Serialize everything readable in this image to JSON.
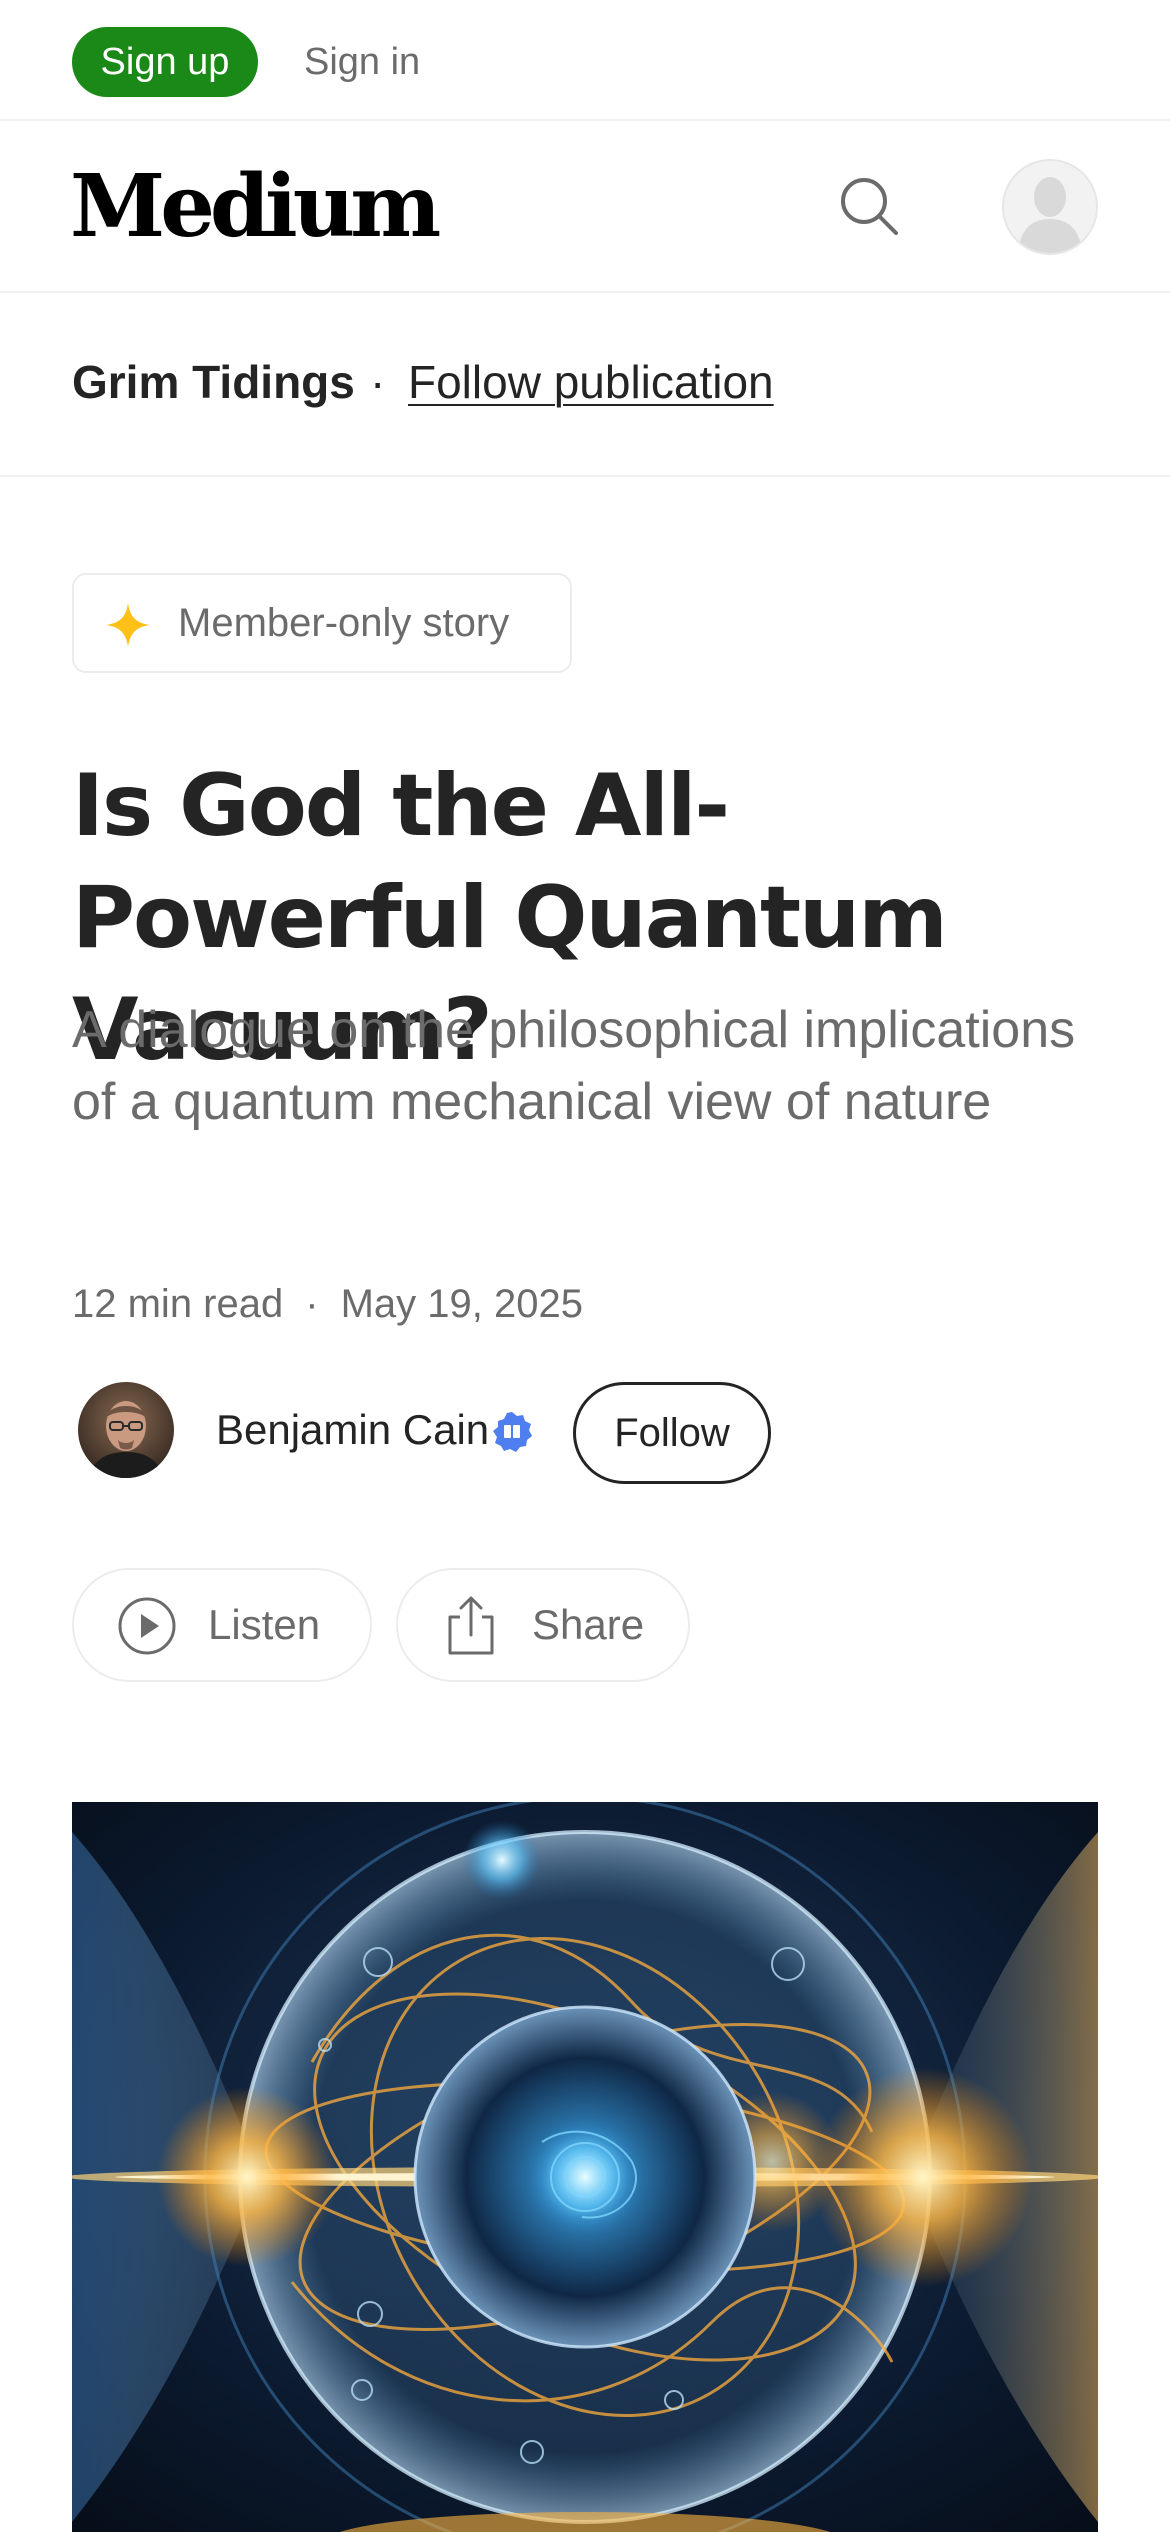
{
  "auth": {
    "signup_label": "Sign up",
    "signin_label": "Sign in"
  },
  "header": {
    "logo_text": "Medium",
    "icons": [
      "search-icon",
      "user-avatar-icon"
    ]
  },
  "publication": {
    "name": "Grim Tidings",
    "separator": "·",
    "follow_label": "Follow publication"
  },
  "badge": {
    "icon": "sparkle-star-icon",
    "label": "Member-only story",
    "color": "#ffc017"
  },
  "article": {
    "title": "Is God the All-Powerful Quantum Vacuum?",
    "subtitle": "A dialogue on the philosophical implications of a quantum mechanical view of nature",
    "read_time": "12 min read",
    "separator": "·",
    "date": "May 19, 2025"
  },
  "author": {
    "name": "Benjamin Cain",
    "follow_label": "Follow",
    "verified_icon": "verified-badge-icon",
    "verified_color": "#4e7ef0"
  },
  "actions": {
    "listen_label": "Listen",
    "share_label": "Share"
  },
  "colors": {
    "signup_green": "#1a8917",
    "text_primary": "#242424",
    "text_secondary": "#6b6b6b"
  }
}
